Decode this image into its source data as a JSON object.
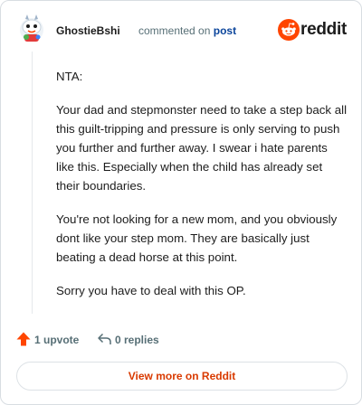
{
  "header": {
    "username": "GhostieBshi",
    "action_text": "commented on",
    "post_link": "post",
    "brand_name": "reddit"
  },
  "comment": {
    "paragraphs": [
      "NTA:",
      "Your dad and stepmonster need to take a step back all this guilt-tripping and pressure is only serving to push you further and further away. I swear i hate parents like this. Especially when the child has already set their boundaries.",
      "You're not looking for a new mom, and you obviously dont like your step mom. They are basically just beating a dead horse at this point.",
      "Sorry you have to deal with this OP."
    ]
  },
  "actions": {
    "upvote_label": "1 upvote",
    "replies_label": "0 replies"
  },
  "cta": {
    "label": "View more on Reddit"
  },
  "colors": {
    "brand_orange": "#ff4500",
    "cta_text": "#d93a00",
    "post_link": "#0a449b",
    "meta_gray": "#576f76"
  },
  "icons": {
    "avatar": "snoo-avatar-icon",
    "brand": "reddit-logo-icon",
    "upvote": "upvote-arrow-icon",
    "reply": "reply-arrow-icon"
  }
}
